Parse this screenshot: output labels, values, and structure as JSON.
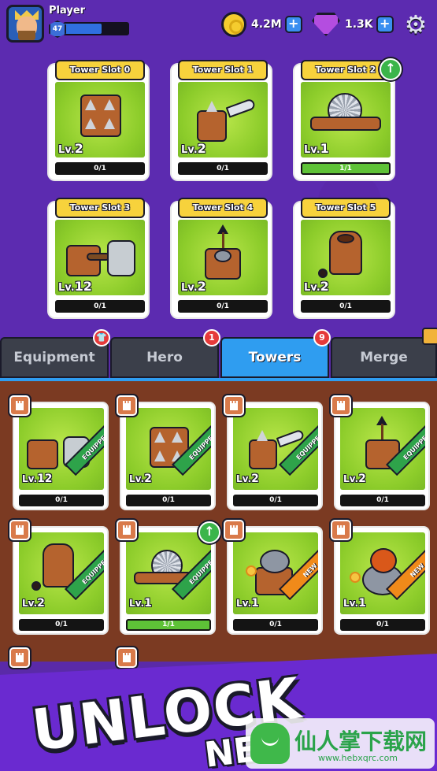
{
  "player": {
    "name": "Player",
    "level": "47",
    "xp_fraction": 0.58
  },
  "currency": {
    "gold": "4.2M",
    "gems": "1.3K",
    "plus": "+"
  },
  "icons": {
    "settings": "gear-icon",
    "upgrade": "up-arrow-icon",
    "castle": "castle-icon",
    "lock": "lock-icon"
  },
  "tower_slots": [
    {
      "title": "Tower Slot 0",
      "lv_prefix": "Lv.",
      "level": "2",
      "count": "0/1"
    },
    {
      "title": "Tower Slot 1",
      "lv_prefix": "Lv.",
      "level": "2",
      "count": "0/1"
    },
    {
      "title": "Tower Slot 2",
      "lv_prefix": "Lv.",
      "level": "1",
      "count": "1/1"
    },
    {
      "title": "Tower Slot 3",
      "lv_prefix": "Lv.",
      "level": "12",
      "count": "0/1"
    },
    {
      "title": "Tower Slot 4",
      "lv_prefix": "Lv.",
      "level": "2",
      "count": "0/1"
    },
    {
      "title": "Tower Slot 5",
      "lv_prefix": "Lv.",
      "level": "2",
      "count": "0/1"
    }
  ],
  "tabs": [
    {
      "label": "Equipment",
      "badge": ""
    },
    {
      "label": "Hero",
      "badge": "1"
    },
    {
      "label": "Towers",
      "badge": "9"
    },
    {
      "label": "Merge",
      "badge": ""
    }
  ],
  "inventory": [
    {
      "lv_prefix": "Lv.",
      "level": "12",
      "count": "0/1",
      "ribbon": "EQUIPPED"
    },
    {
      "lv_prefix": "Lv.",
      "level": "2",
      "count": "0/1",
      "ribbon": "EQUIPPED"
    },
    {
      "lv_prefix": "Lv.",
      "level": "2",
      "count": "0/1",
      "ribbon": "EQUIPPED"
    },
    {
      "lv_prefix": "Lv.",
      "level": "2",
      "count": "0/1",
      "ribbon": "EQUIPPED"
    },
    {
      "lv_prefix": "Lv.",
      "level": "2",
      "count": "0/1",
      "ribbon": "EQUIPPED"
    },
    {
      "lv_prefix": "Lv.",
      "level": "1",
      "count": "1/1",
      "ribbon": "EQUIPPED"
    },
    {
      "lv_prefix": "Lv.",
      "level": "1",
      "count": "0/1",
      "ribbon": "NEW"
    },
    {
      "lv_prefix": "Lv.",
      "level": "1",
      "count": "0/1",
      "ribbon": "NEW"
    }
  ],
  "promo": {
    "line1": "UNLOCK",
    "line2": "NE"
  },
  "watermark": {
    "title": "仙人掌下载网",
    "url": "www.hebxqrc.com"
  },
  "colors": {
    "accent": "#2f9df0",
    "gold": "#f7d23c",
    "equipped": "#2ea34a",
    "new": "#f08a1a",
    "purple_bg": "#5c2bb0",
    "brown_bg": "#7b3a22"
  }
}
